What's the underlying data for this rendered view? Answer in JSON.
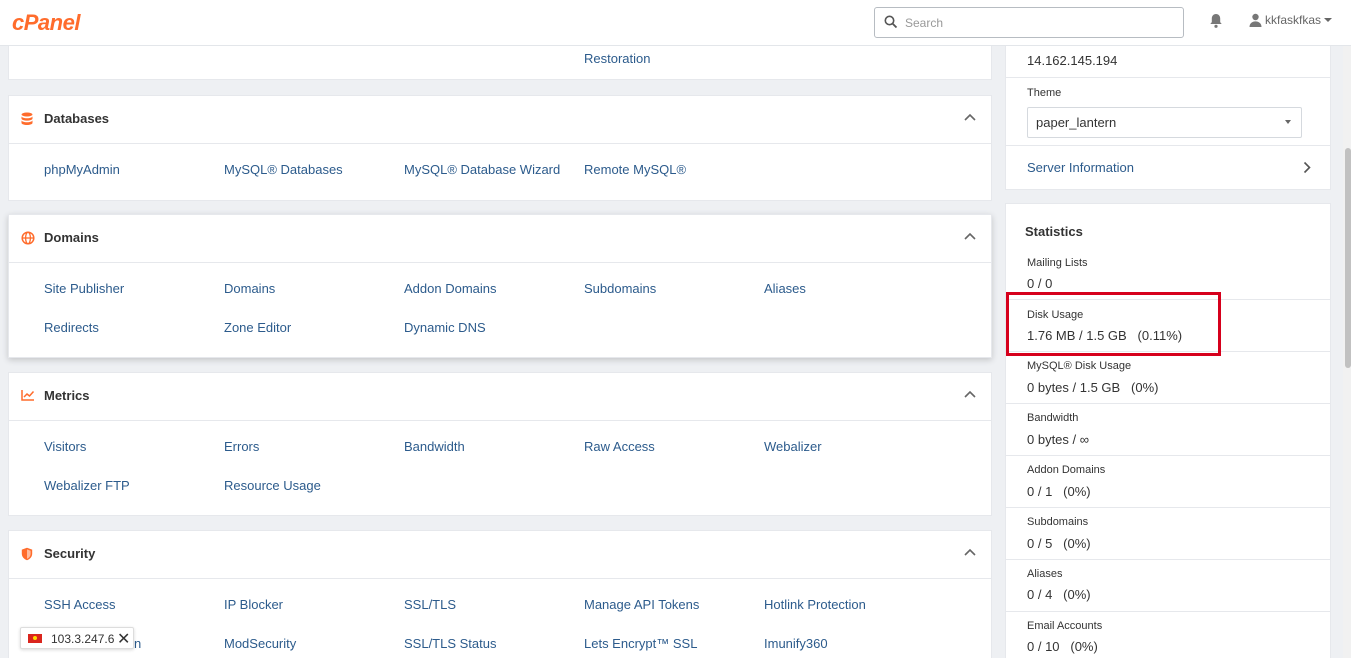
{
  "header": {
    "logo": "cPanel",
    "search_placeholder": "Search",
    "username": "kkfaskfkas"
  },
  "sections": {
    "top_partial": {
      "links": [
        "Restoration"
      ]
    },
    "databases": {
      "title": "Databases",
      "links": [
        "phpMyAdmin",
        "MySQL® Databases",
        "MySQL® Database Wizard",
        "Remote MySQL®"
      ]
    },
    "domains": {
      "title": "Domains",
      "links": [
        "Site Publisher",
        "Domains",
        "Addon Domains",
        "Subdomains",
        "Aliases",
        "Redirects",
        "Zone Editor",
        "Dynamic DNS"
      ]
    },
    "metrics": {
      "title": "Metrics",
      "links": [
        "Visitors",
        "Errors",
        "Bandwidth",
        "Raw Access",
        "Webalizer",
        "Webalizer FTP",
        "Resource Usage"
      ]
    },
    "security": {
      "title": "Security",
      "links": [
        "SSH Access",
        "IP Blocker",
        "SSL/TLS",
        "Manage API Tokens",
        "Hotlink Protection",
        "n",
        "ModSecurity",
        "SSL/TLS Status",
        "Lets Encrypt™ SSL",
        "Imunify360"
      ]
    }
  },
  "sidebar": {
    "ip_address": "14.162.145.194",
    "theme_label": "Theme",
    "theme_value": "paper_lantern",
    "server_info": "Server Information",
    "statistics_title": "Statistics",
    "stats": [
      {
        "label": "Mailing Lists",
        "value": "0 / 0"
      },
      {
        "label": "Disk Usage",
        "value": "1.76 MB / 1.5 GB   (0.11%)"
      },
      {
        "label": "MySQL® Disk Usage",
        "value": "0 bytes / 1.5 GB   (0%)"
      },
      {
        "label": "Bandwidth",
        "value": "0 bytes / ∞"
      },
      {
        "label": "Addon Domains",
        "value": "0 / 1   (0%)"
      },
      {
        "label": "Subdomains",
        "value": "0 / 5   (0%)"
      },
      {
        "label": "Aliases",
        "value": "0 / 4   (0%)"
      },
      {
        "label": "Email Accounts",
        "value": "0 / 10   (0%)"
      }
    ]
  },
  "ip_badge": {
    "ip": "103.3.247.6",
    "close": "✕"
  },
  "colors": {
    "accent": "#ff6c2c",
    "link": "#2c5b8c",
    "highlight": "#d6001c"
  },
  "icons": [
    "search-icon",
    "bell-icon",
    "user-icon",
    "database-icon",
    "globe-icon",
    "chart-icon",
    "shield-icon",
    "chevron-up-icon",
    "chevron-right-icon",
    "caret-down-icon",
    "flag-icon",
    "close-icon"
  ]
}
